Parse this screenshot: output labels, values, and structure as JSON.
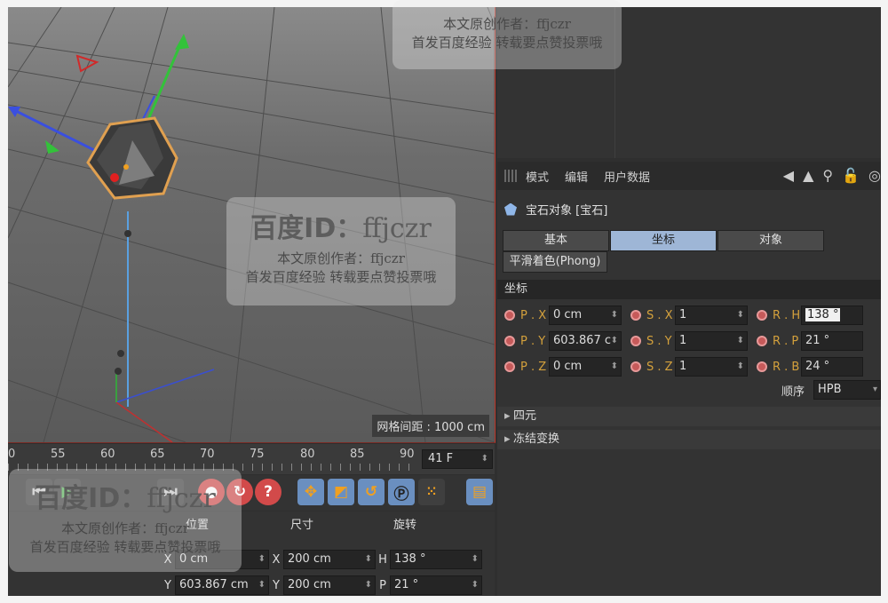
{
  "viewport": {
    "grid_spacing": "网格间距 : 1000 cm"
  },
  "attribute_manager": {
    "menu": [
      "模式",
      "编辑",
      "用户数据"
    ],
    "tool_icons": [
      "arrow-left-icon",
      "arrow-up-icon",
      "search-icon",
      "lock-icon",
      "target-icon"
    ],
    "object_title": "宝石对象 [宝石]",
    "tabs": [
      "基本",
      "坐标",
      "对象"
    ],
    "active_tab": "坐标",
    "phong_tab": "平滑着色(Phong)",
    "section_title": "坐标",
    "rows": [
      [
        {
          "label": "P . X",
          "value": "0 cm"
        },
        {
          "label": "S . X",
          "value": "1"
        },
        {
          "label": "R . H",
          "value": "138 °"
        }
      ],
      [
        {
          "label": "P . Y",
          "value": "603.867 c"
        },
        {
          "label": "S . Y",
          "value": "1"
        },
        {
          "label": "R . P",
          "value": "21 °"
        }
      ],
      [
        {
          "label": "P . Z",
          "value": "0 cm"
        },
        {
          "label": "S . Z",
          "value": "1"
        },
        {
          "label": "R . B",
          "value": "24 °"
        }
      ]
    ],
    "order_label": "顺序",
    "order_value": "HPB",
    "collapsed": [
      "四元",
      "冻结变换"
    ]
  },
  "timeline": {
    "ticks": [
      "0",
      "55",
      "60",
      "65",
      "70",
      "75",
      "80",
      "85",
      "90"
    ],
    "current_frame": "41 F"
  },
  "coordinates": {
    "headers": [
      "位置",
      "尺寸",
      "旋转"
    ],
    "rows": [
      {
        "pos_label": "X",
        "pos": "0 cm",
        "size_label": "X",
        "size": "200 cm",
        "rot_label": "H",
        "rot": "138 °"
      },
      {
        "pos_label": "Y",
        "pos": "603.867 cm",
        "size_label": "Y",
        "size": "200 cm",
        "rot_label": "P",
        "rot": "21 °"
      }
    ]
  },
  "watermarks": [
    {
      "big": "百度ID：",
      "big2": "ffjczr",
      "line1": "本文原创作者：ffjczr",
      "line2": "首发百度经验 转载要点赞投票哦"
    },
    {
      "line1": "本文原创作者：ffjczr",
      "line2": "首发百度经验 转载要点赞投票哦"
    },
    {
      "big": "百度ID：",
      "big2": "ffjczr",
      "line1": "本文原创作者：ffjczr",
      "line2": "首发百度经验 转载要点赞投票哦"
    }
  ]
}
